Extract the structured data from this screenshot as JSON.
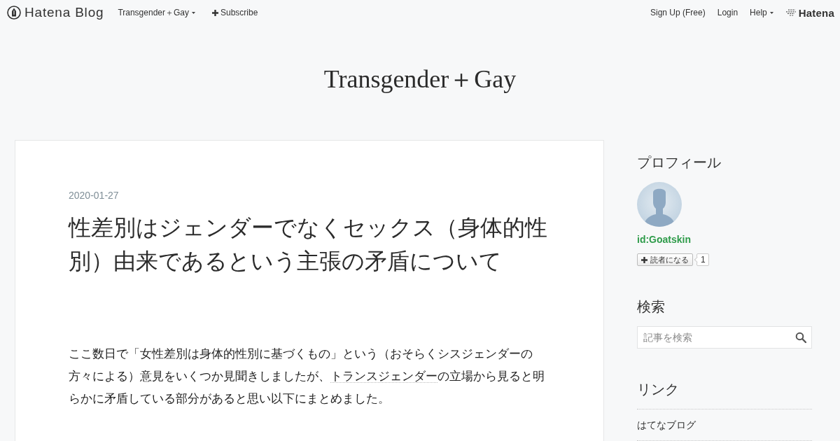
{
  "global_header": {
    "logo": "Hatena Blog",
    "blog_menu": {
      "label": "Transgender＋Gay"
    },
    "subscribe": {
      "label": "Subscribe"
    },
    "links": [
      {
        "label": "Sign Up (Free)",
        "kind": "link"
      },
      {
        "label": "Login",
        "kind": "link"
      },
      {
        "label": "Help",
        "kind": "menu"
      }
    ],
    "brand": "Hatena"
  },
  "blog_title": "Transgender＋Gay",
  "entry": {
    "date": "2020-01-27",
    "title": "性差別はジェンダーでなくセックス（身体的性別）由来であるという主張の矛盾について",
    "body": [
      {
        "kind": "text",
        "text": "ここ数日で「女性差別は身体的性別に基づくもの」という（おそらくシスジェンダーの方々による）意見をいくつか見聞きしましたが、"
      },
      {
        "kind": "keyword",
        "text": "トランスジェンダー"
      },
      {
        "kind": "text",
        "text": "の立場から見ると明らかに矛盾している部分があると思い以下にまとめました。"
      }
    ]
  },
  "sidebar": {
    "modules": [
      {
        "kind": "profile",
        "title": "プロフィール",
        "user_id": "id:Goatskin",
        "subscribe_label": "読者になる",
        "reader_count": "1"
      },
      {
        "kind": "search",
        "title": "検索",
        "placeholder": "記事を検索"
      },
      {
        "kind": "links",
        "title": "リンク",
        "items": [
          {
            "label": "はてなブログ"
          }
        ]
      }
    ]
  }
}
